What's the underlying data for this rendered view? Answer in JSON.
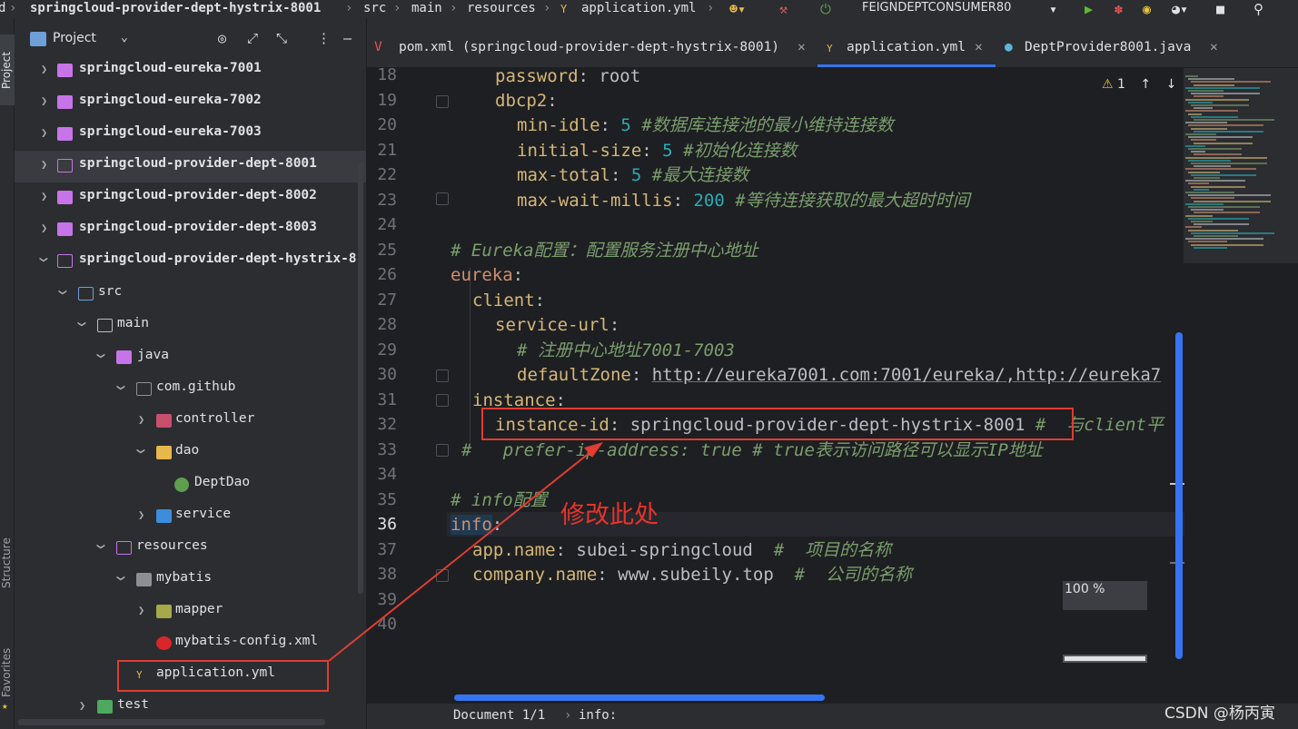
{
  "navbar": {
    "project_crumb": "springcloud-provider-dept-hystrix-8001",
    "crumbs": [
      "src",
      "main",
      "resources",
      "application.yml"
    ],
    "run_config": "FEIGNDEPTCONSUMER80",
    "icons": [
      "yaml-icon",
      "users-icon",
      "hammer-icon",
      "power-icon",
      "run-icon",
      "debug-icon",
      "coverage-icon",
      "profiler-icon",
      "stop-icon",
      "search-icon"
    ]
  },
  "left_strip": {
    "project": "Project",
    "structure": "Structure",
    "favorites": "Favorites"
  },
  "project_panel": {
    "title": "Project",
    "items": [
      {
        "label": "springcloud-eureka-7001",
        "bold": true
      },
      {
        "label": "springcloud-eureka-7002",
        "bold": true
      },
      {
        "label": "springcloud-eureka-7003",
        "bold": true
      },
      {
        "label": "springcloud-provider-dept-8001",
        "bold": true
      },
      {
        "label": "springcloud-provider-dept-8002",
        "bold": true
      },
      {
        "label": "springcloud-provider-dept-8003",
        "bold": true
      },
      {
        "label": "springcloud-provider-dept-hystrix-8",
        "bold": true
      },
      {
        "label": "src"
      },
      {
        "label": "main"
      },
      {
        "label": "java"
      },
      {
        "label": "com.github"
      },
      {
        "label": "controller"
      },
      {
        "label": "dao"
      },
      {
        "label": "DeptDao"
      },
      {
        "label": "service"
      },
      {
        "label": "resources"
      },
      {
        "label": "mybatis"
      },
      {
        "label": "mapper"
      },
      {
        "label": "mybatis-config.xml"
      },
      {
        "label": "application.yml"
      },
      {
        "label": "test"
      }
    ]
  },
  "tabs": [
    {
      "label": "pom.xml (springcloud-provider-dept-hystrix-8001)"
    },
    {
      "label": "application.yml"
    },
    {
      "label": "DeptProvider8001.java"
    }
  ],
  "editor": {
    "line_numbers": [
      "18",
      "19",
      "20",
      "21",
      "22",
      "23",
      "24",
      "25",
      "26",
      "27",
      "28",
      "29",
      "30",
      "31",
      "32",
      "33",
      "34",
      "35",
      "36",
      "37",
      "38",
      "39",
      "40"
    ],
    "current_line": "36",
    "lines": {
      "l18_key": "password",
      "l18_val": "root",
      "l19_key": "dbcp2",
      "l20_key": "min-idle",
      "l20_val": "5",
      "l20_cmt": "#数据库连接池的最小维持连接数",
      "l21_key": "initial-size",
      "l21_val": "5",
      "l21_cmt": "#初始化连接数",
      "l22_key": "max-total",
      "l22_val": "5",
      "l22_cmt": "#最大连接数",
      "l23_key": "max-wait-millis",
      "l23_val": "200",
      "l23_cmt": "#等待连接获取的最大超时时间",
      "l25_cmt": "# Eureka配置：配置服务注册中心地址",
      "l26_key": "eureka",
      "l27_key": "client",
      "l28_key": "service-url",
      "l29_cmt": "# 注册中心地址7001-7003",
      "l30_key": "defaultZone",
      "l30_val": "http://eureka7001.com:7001/eureka/,http://eureka7",
      "l31_key": "instance",
      "l32_key": "instance-id",
      "l32_val": "springcloud-provider-dept-hystrix-8001",
      "l32_cmt": "#  与client平",
      "l33_cmt": "#   prefer-ip-address: true # true表示访问路径可以显示IP地址",
      "l35_cmt": "# info配置",
      "l36_key": "info",
      "l37_key": "app.name",
      "l37_val": "subei-springcloud",
      "l37_cmt": "#  项目的名称",
      "l38_key": "company.name",
      "l38_val": "www.subeily.top",
      "l38_cmt": "#  公司的名称"
    },
    "annotation": "修改此处",
    "zoom": "100 %",
    "warnings": "1"
  },
  "status": {
    "breadcrumb_doc": "Document 1/1",
    "breadcrumb_key": "info:"
  },
  "watermark": "CSDN @杨丙寅"
}
